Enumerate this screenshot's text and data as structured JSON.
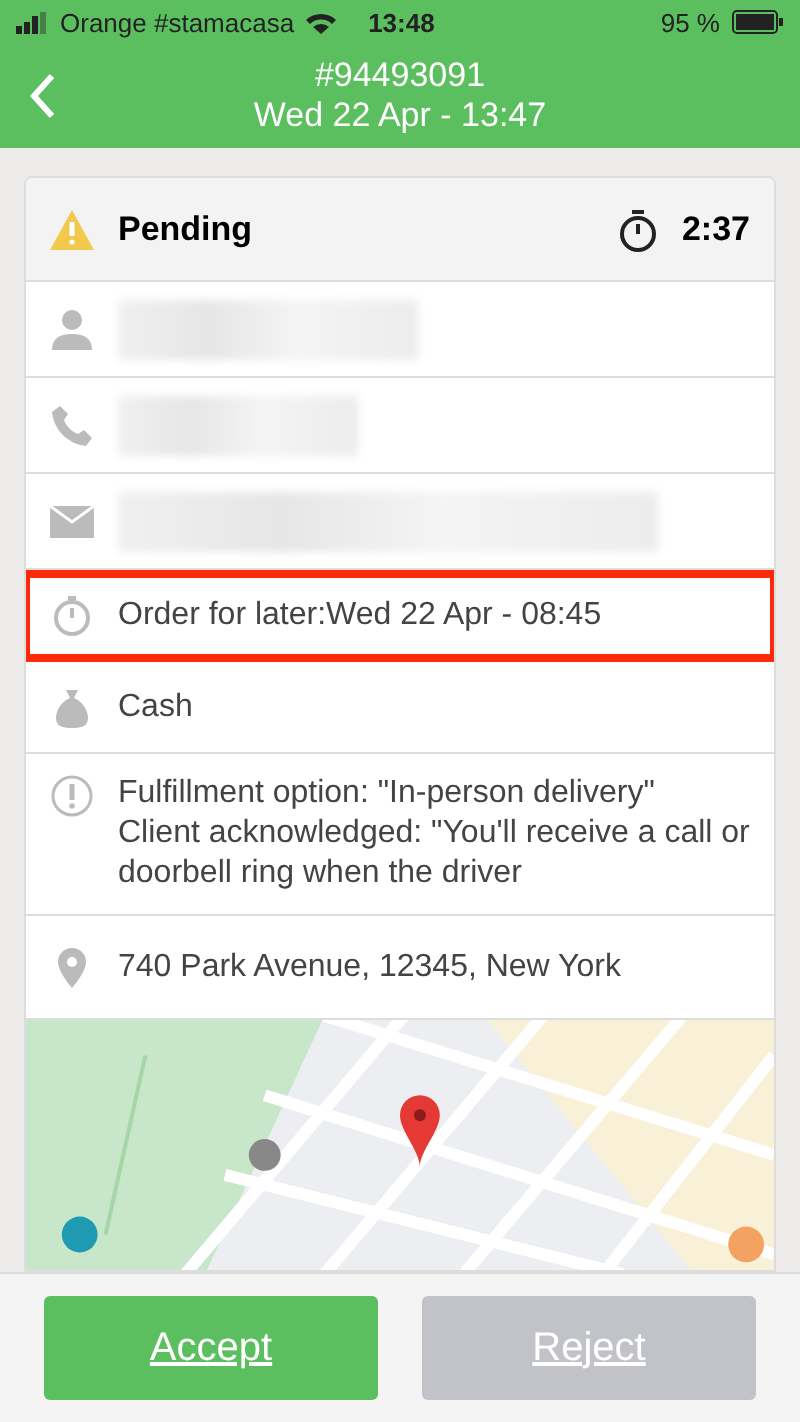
{
  "status_bar": {
    "carrier": "Orange #stamacasa",
    "time": "13:48",
    "battery": "95 %"
  },
  "header": {
    "order_number": "#94493091",
    "date": "Wed 22 Apr - 13:47"
  },
  "order": {
    "status": "Pending",
    "timer": "2:37"
  },
  "rows": [
    {
      "kind": "person",
      "redacted": true
    },
    {
      "kind": "phone",
      "redacted": true
    },
    {
      "kind": "email",
      "redacted": true
    },
    {
      "kind": "later",
      "text": "Order for later:Wed 22 Apr - 08:45",
      "highlighted": true
    },
    {
      "kind": "payment",
      "text": "Cash",
      "highlighted": false
    },
    {
      "kind": "note",
      "text": "Fulfillment option: \"In-person delivery\"\nClient acknowledged: \"You'll receive a call or doorbell ring when the driver",
      "highlighted": false
    },
    {
      "kind": "address",
      "text": "740 Park Avenue, 12345, New York",
      "highlighted": false
    }
  ],
  "buttons": [
    {
      "label": "Accept",
      "disabled": false
    },
    {
      "label": "Reject",
      "disabled": true
    }
  ]
}
